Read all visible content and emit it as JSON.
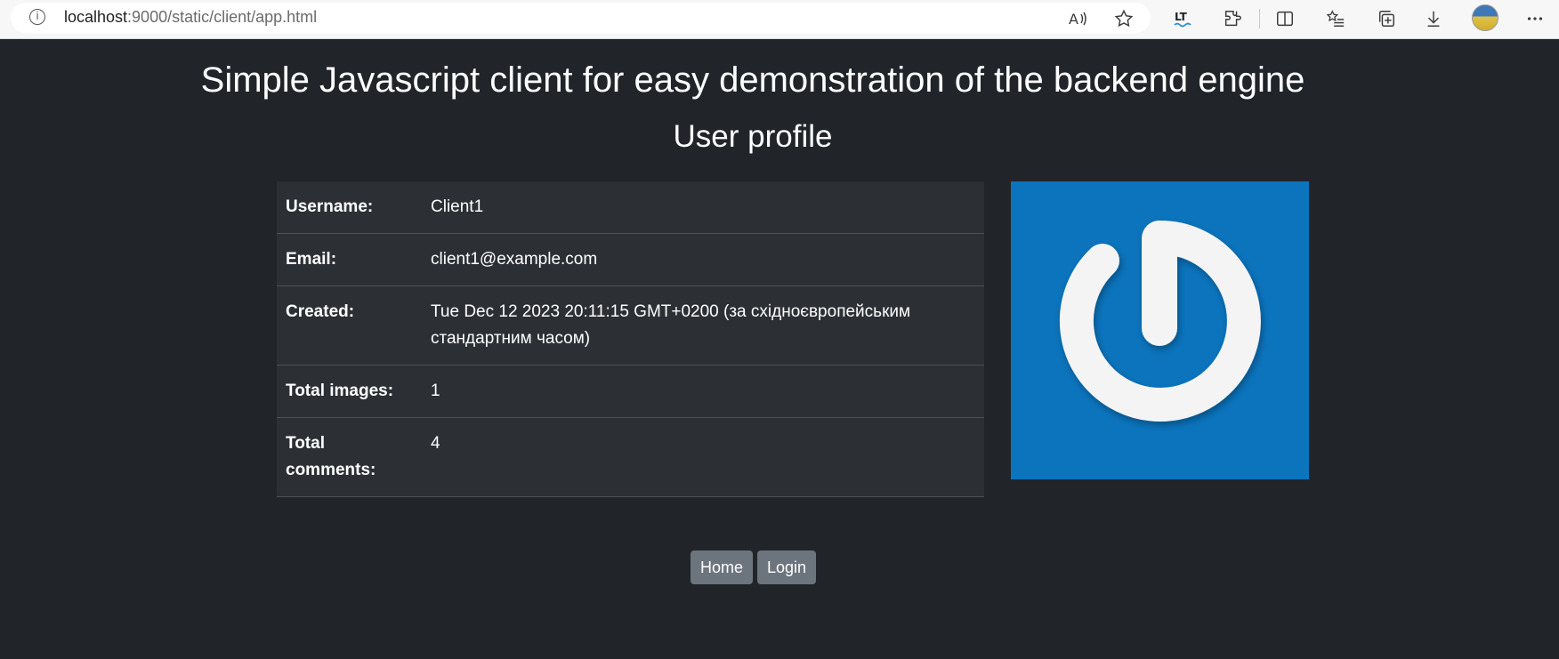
{
  "browser": {
    "url_host": "localhost",
    "url_path": ":9000/static/client/app.html"
  },
  "page": {
    "title": "Simple Javascript client for easy demonstration of the backend engine",
    "subtitle": "User profile"
  },
  "profile": {
    "rows": [
      {
        "label": "Username:",
        "value": "Client1"
      },
      {
        "label": "Email:",
        "value": "client1@example.com"
      },
      {
        "label": "Created:",
        "value": "Tue Dec 12 2023 20:11:15 GMT+0200 (за східноєвропейським стандартним часом)"
      },
      {
        "label": "Total images:",
        "value": "1"
      },
      {
        "label": "Total comments:",
        "value": "4"
      }
    ]
  },
  "buttons": {
    "home": "Home",
    "login": "Login"
  },
  "colors": {
    "background": "#212529",
    "table_bg": "#2c3034",
    "button_bg": "#6c757d",
    "image_bg": "#0b74bd"
  }
}
